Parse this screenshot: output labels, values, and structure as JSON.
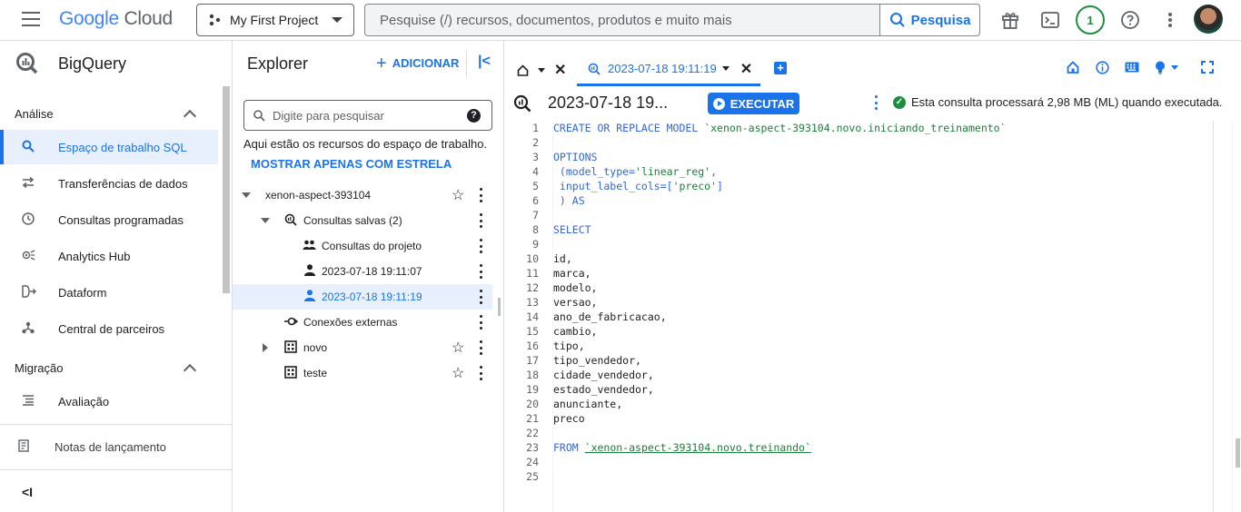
{
  "topbar": {
    "logo_google": "Google",
    "logo_cloud": "Cloud",
    "project": "My First Project",
    "search_placeholder": "Pesquise (/) recursos, documentos, produtos e muito mais",
    "search_button": "Pesquisa",
    "notifications_count": "1"
  },
  "nav": {
    "title": "BigQuery",
    "section_analysis": "Análise",
    "items": [
      {
        "label": "Espaço de trabalho SQL",
        "icon": "search-icon"
      },
      {
        "label": "Transferências de dados",
        "icon": "transfer-icon"
      },
      {
        "label": "Consultas programadas",
        "icon": "clock-icon"
      },
      {
        "label": "Analytics Hub",
        "icon": "hub-icon"
      },
      {
        "label": "Dataform",
        "icon": "dataform-icon"
      },
      {
        "label": "Central de parceiros",
        "icon": "partners-icon"
      }
    ],
    "section_migration": "Migração",
    "migration_items": [
      {
        "label": "Avaliação",
        "icon": "list-icon"
      }
    ],
    "release_notes": "Notas de lançamento"
  },
  "explorer": {
    "title": "Explorer",
    "add_label": "ADICIONAR",
    "search_placeholder": "Digite para pesquisar",
    "info": "Aqui estão os recursos do espaço de trabalho.",
    "starred_only": "MOSTRAR APENAS COM ESTRELA",
    "tree": {
      "project": "xenon-aspect-393104",
      "saved_queries": "Consultas salvas (2)",
      "project_queries": "Consultas do projeto",
      "query1": "2023-07-18 19:11:07",
      "query2": "2023-07-18 19:11:19",
      "external": "Conexões externas",
      "dataset1": "novo",
      "dataset2": "teste"
    }
  },
  "editor": {
    "tab_title": "2023-07-18 19:11:19",
    "query_title": "2023-07-18 19...",
    "run_label": "EXECUTAR",
    "status": "Esta consulta processará 2,98 MB (ML) quando executada.",
    "line_numbers": [
      "1",
      "2",
      "3",
      "4",
      "5",
      "6",
      "7",
      "8",
      "9",
      "10",
      "11",
      "12",
      "13",
      "14",
      "15",
      "16",
      "17",
      "18",
      "19",
      "20",
      "21",
      "22",
      "23",
      "24",
      "25"
    ],
    "code": {
      "l1_kw": "CREATE OR REPLACE MODEL",
      "l1_name": "`xenon-aspect-393104.novo.iniciando_treinamento`",
      "l3": "OPTIONS",
      "l4_a": " (model_type=",
      "l4_str": "'linear_reg'",
      "l4_b": ",",
      "l5_a": " input_label_cols=[",
      "l5_str": "'preco'",
      "l5_b": "]",
      "l6": " ) AS",
      "l8": "SELECT",
      "l10": "id,",
      "l11": "marca,",
      "l12": "modelo,",
      "l13": "versao,",
      "l14": "ano_de_fabricacao,",
      "l15": "cambio,",
      "l16": "tipo,",
      "l17": "tipo_vendedor,",
      "l18": "cidade_vendedor,",
      "l19": "estado_vendedor,",
      "l20": "anunciante,",
      "l21": "preco",
      "l23_kw": "FROM",
      "l23_name": "`xenon-aspect-393104.novo.treinando`"
    }
  },
  "colors": {
    "accent": "#1a73e8",
    "success": "#1e8e3e",
    "selected_bg": "#e8f0fe"
  }
}
